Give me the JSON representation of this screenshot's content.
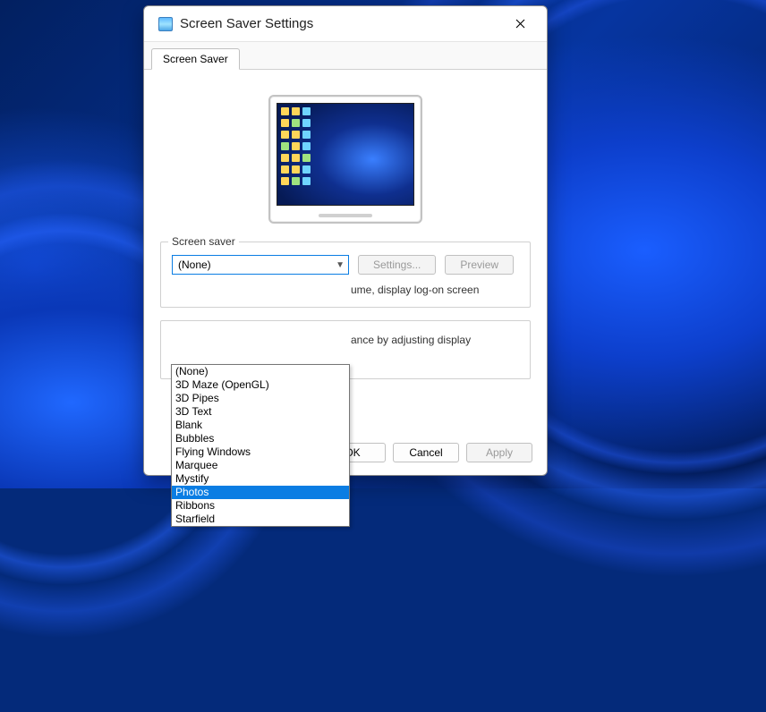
{
  "window": {
    "title": "Screen Saver Settings"
  },
  "tab": {
    "label": "Screen Saver"
  },
  "group": {
    "label": "Screen saver",
    "combo_value": "(None)",
    "settings_button": "Settings...",
    "preview_button": "Preview",
    "resume_fragment": "ume, display log-on screen",
    "perf_fragment": "ance by adjusting display"
  },
  "dropdown_options": [
    "(None)",
    "3D Maze (OpenGL)",
    "3D Pipes",
    "3D Text",
    "Blank",
    "Bubbles",
    "Flying Windows",
    "Marquee",
    "Mystify",
    "Photos",
    "Ribbons",
    "Starfield"
  ],
  "dropdown_selected_index": 9,
  "footer": {
    "ok": "OK",
    "cancel": "Cancel",
    "apply": "Apply"
  }
}
